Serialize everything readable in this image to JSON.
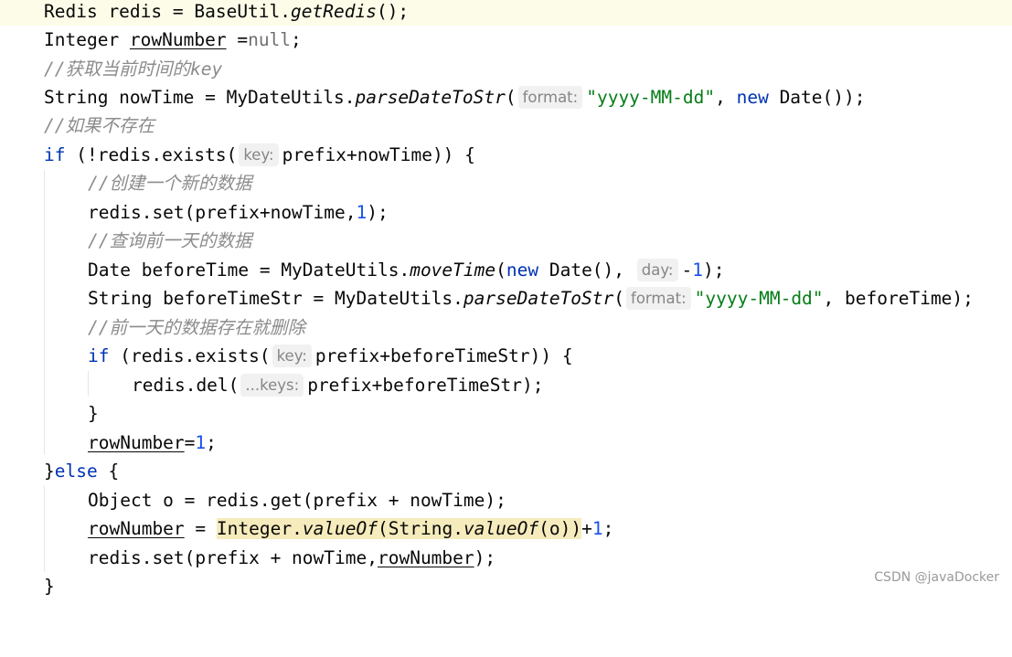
{
  "editor": {
    "language": "java",
    "lines": {
      "l1": {
        "a": "Redis redis = BaseUtil.",
        "b": "getRedis",
        "c": "();"
      },
      "l2": {
        "a": "Integer ",
        "b": "rowNumber",
        "c": " =",
        "d": "null",
        "e": ";"
      },
      "l3": {
        "text": "//获取当前时间的key"
      },
      "l4": {
        "a": "String nowTime = MyDateUtils.",
        "b": "parseDateToStr",
        "c": "(",
        "hint": "format:",
        "str": "\"yyyy-MM-dd\"",
        "d": ", ",
        "kw": "new",
        "e": " Date());"
      },
      "l5": {
        "text": "//如果不存在"
      },
      "l6": {
        "kw": "if",
        "a": " (!redis.exists(",
        "hint": "key:",
        "b": "prefix+nowTime)) {"
      },
      "l7": {
        "text": "//创建一个新的数据"
      },
      "l8": {
        "a": "redis.set(prefix+nowTime,",
        "num": "1",
        "b": ");"
      },
      "l9": {
        "text": "//查询前一天的数据"
      },
      "l10": {
        "a": "Date beforeTime = MyDateUtils.",
        "b": "moveTime",
        "c": "(",
        "kw": "new",
        "d": " Date(), ",
        "hint": "day:",
        "e": "-",
        "num": "1",
        "f": ");"
      },
      "l11": {
        "a": "String beforeTimeStr = MyDateUtils.",
        "b": "parseDateToStr",
        "c": "(",
        "hint": "format:",
        "str": "\"yyyy-MM-dd\"",
        "d": ", beforeTime);"
      },
      "l12": {
        "text": "//前一天的数据存在就删除"
      },
      "l13": {
        "kw": "if",
        "a": " (redis.exists(",
        "hint": "key:",
        "b": "prefix+beforeTimeStr)) {"
      },
      "l14": {
        "a": "redis.del(",
        "hint": "...keys:",
        "b": "prefix+beforeTimeStr);"
      },
      "l15": {
        "text": "}"
      },
      "l16": {
        "a": "rowNumber",
        "b": "=",
        "num": "1",
        "c": ";"
      },
      "l17": {
        "a": "}",
        "kw": "else",
        "b": " {"
      },
      "l18": {
        "text": "Object o = redis.get(prefix + nowTime);"
      },
      "l19": {
        "a": "rowNumber",
        "b": " = ",
        "c": "Integer.",
        "d": "valueOf",
        "e": "(String.",
        "f": "valueOf",
        "g": "(o))",
        "h": "+",
        "num": "1",
        "i": ";"
      },
      "l20": {
        "a": "redis.set(prefix + nowTime,",
        "b": "rowNumber",
        "c": ");"
      },
      "l21": {
        "text": "}"
      }
    }
  },
  "watermark": "CSDN @javaDocker"
}
